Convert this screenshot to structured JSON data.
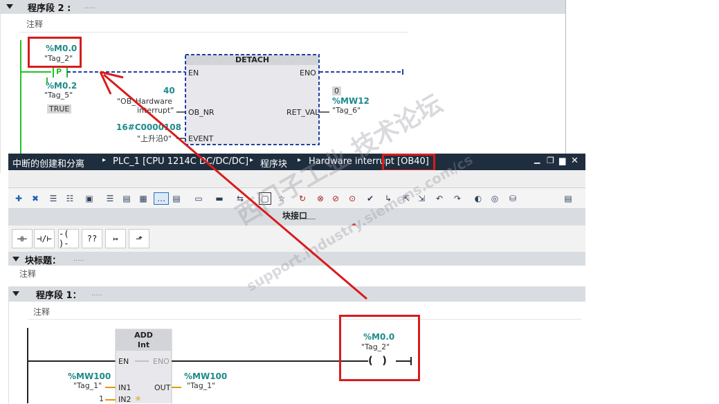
{
  "top": {
    "section_title": "程序段 2 :",
    "section_dots": ".....",
    "comment": "注释",
    "contact_addr": "%M0.0",
    "contact_tag": "\"Tag_2\"",
    "p_label": "P",
    "edge_addr": "%M0.2",
    "edge_tag": "\"Tag_5\"",
    "edge_value": "TRUE",
    "block_name": "DETACH",
    "pin_en": "EN",
    "pin_eno": "ENO",
    "pin_obnr": "OB_NR",
    "pin_retval": "RET_VAL",
    "pin_event": "EVENT",
    "obnr_value": "40",
    "obnr_tag_line1": "\"OB_Hardware",
    "obnr_tag_line2": "interrupt\"",
    "event_value": "16#C0000108",
    "event_tag": "\"上升沿0\"",
    "retval_chip": "0",
    "retval_addr": "%MW12",
    "retval_tag": "\"Tag_6\""
  },
  "window": {
    "breadcrumb": [
      "中断的创建和分离",
      "PLC_1 [CPU 1214C DC/DC/DC]",
      "程序块",
      "Hardware interrupt [OB40]"
    ],
    "breadcrumb_sep": "▸",
    "controls": [
      "▁",
      "❐",
      "▆",
      "✕"
    ],
    "interface_label": "块接口",
    "toolbar_icons": [
      "insert-network-icon",
      "delete-network-icon",
      "insert-row-icon",
      "add-row-icon",
      "local-var-icon",
      "absolute-icon",
      "network-open-icon",
      "network-close-icon",
      "comment-icon",
      "favorites-icon",
      "monitor-icon",
      "goto-icon",
      "status-icon",
      "view-icon",
      "favorites-star-icon",
      "rung-refresh-icon",
      "rung-delete-icon",
      "call-icon",
      "call-delete-icon",
      "check-icon",
      "jump-icon",
      "jump-end-icon",
      "step-icon",
      "back-icon",
      "forward-icon",
      "colors-icon",
      "glasses-icon",
      "database-icon",
      "side-panel-icon"
    ],
    "ladder_buttons": [
      {
        "name": "no-contact-button",
        "glyph": "⊣⊢"
      },
      {
        "name": "nc-contact-button",
        "glyph": "⊣/⊢"
      },
      {
        "name": "coil-button",
        "glyph": "-( )-"
      },
      {
        "name": "empty-box-button",
        "glyph": "??"
      },
      {
        "name": "open-branch-button",
        "glyph": "↦"
      },
      {
        "name": "close-branch-button",
        "glyph": "⬏"
      }
    ],
    "block_title_label": "块标题：",
    "block_title_dots": ".....",
    "block_comment": "注释",
    "network1_label": "程序段 1：",
    "network1_dots": ".....",
    "network1_comment": "注释",
    "add_name": "ADD",
    "add_type": "Int",
    "add_en": "EN",
    "add_eno": "ENO",
    "add_in1": "IN1",
    "add_in2": "IN2",
    "add_out": "OUT",
    "in1_addr": "%MW100",
    "in1_tag": "\"Tag_1\"",
    "in2_value": "1",
    "out_addr": "%MW100",
    "out_tag": "\"Tag_1\"",
    "coil_addr": "%M0.0",
    "coil_tag": "\"Tag_2\"",
    "coil_glyph": "( )"
  },
  "watermark": {
    "line1": "西门子工业 技术论坛",
    "line2": "support.industry.siemens.com/cs"
  },
  "colors": {
    "accent_red": "#d81b1b",
    "teal": "#1e8a8a",
    "title_bar": "#1f2e3e",
    "rung_green": "#22c322",
    "dashed_blue": "#1f3fa8"
  }
}
